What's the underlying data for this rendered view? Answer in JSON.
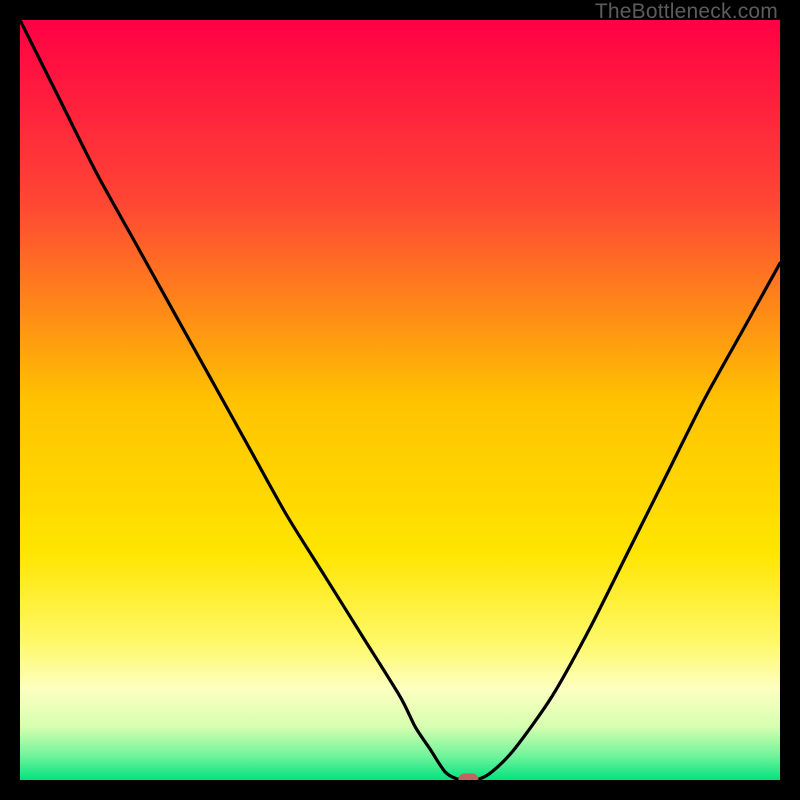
{
  "watermark": "TheBottleneck.com",
  "chart_data": {
    "type": "line",
    "title": "",
    "xlabel": "",
    "ylabel": "",
    "xlim": [
      0,
      100
    ],
    "ylim": [
      0,
      100
    ],
    "grid": false,
    "background": "rainbow-gradient",
    "series": [
      {
        "name": "bottleneck-curve",
        "x": [
          0,
          5,
          10,
          15,
          20,
          25,
          30,
          35,
          40,
          45,
          50,
          52,
          54,
          56,
          58,
          60,
          62,
          65,
          70,
          75,
          80,
          85,
          90,
          95,
          100
        ],
        "y": [
          100,
          90,
          80,
          71,
          62,
          53,
          44,
          35,
          27,
          19,
          11,
          7,
          4,
          1,
          0,
          0,
          1,
          4,
          11,
          20,
          30,
          40,
          50,
          59,
          68
        ]
      }
    ],
    "marker": {
      "x": 59,
      "y": 0,
      "color": "#c1645f"
    },
    "gradient_stops": [
      {
        "offset": 0,
        "color": "#ff0044"
      },
      {
        "offset": 24,
        "color": "#ff4634"
      },
      {
        "offset": 50,
        "color": "#ffc200"
      },
      {
        "offset": 70,
        "color": "#ffe500"
      },
      {
        "offset": 82,
        "color": "#fff96a"
      },
      {
        "offset": 88,
        "color": "#fdffc0"
      },
      {
        "offset": 93,
        "color": "#d6ffb0"
      },
      {
        "offset": 97,
        "color": "#6bf39b"
      },
      {
        "offset": 100,
        "color": "#02e37e"
      }
    ]
  }
}
